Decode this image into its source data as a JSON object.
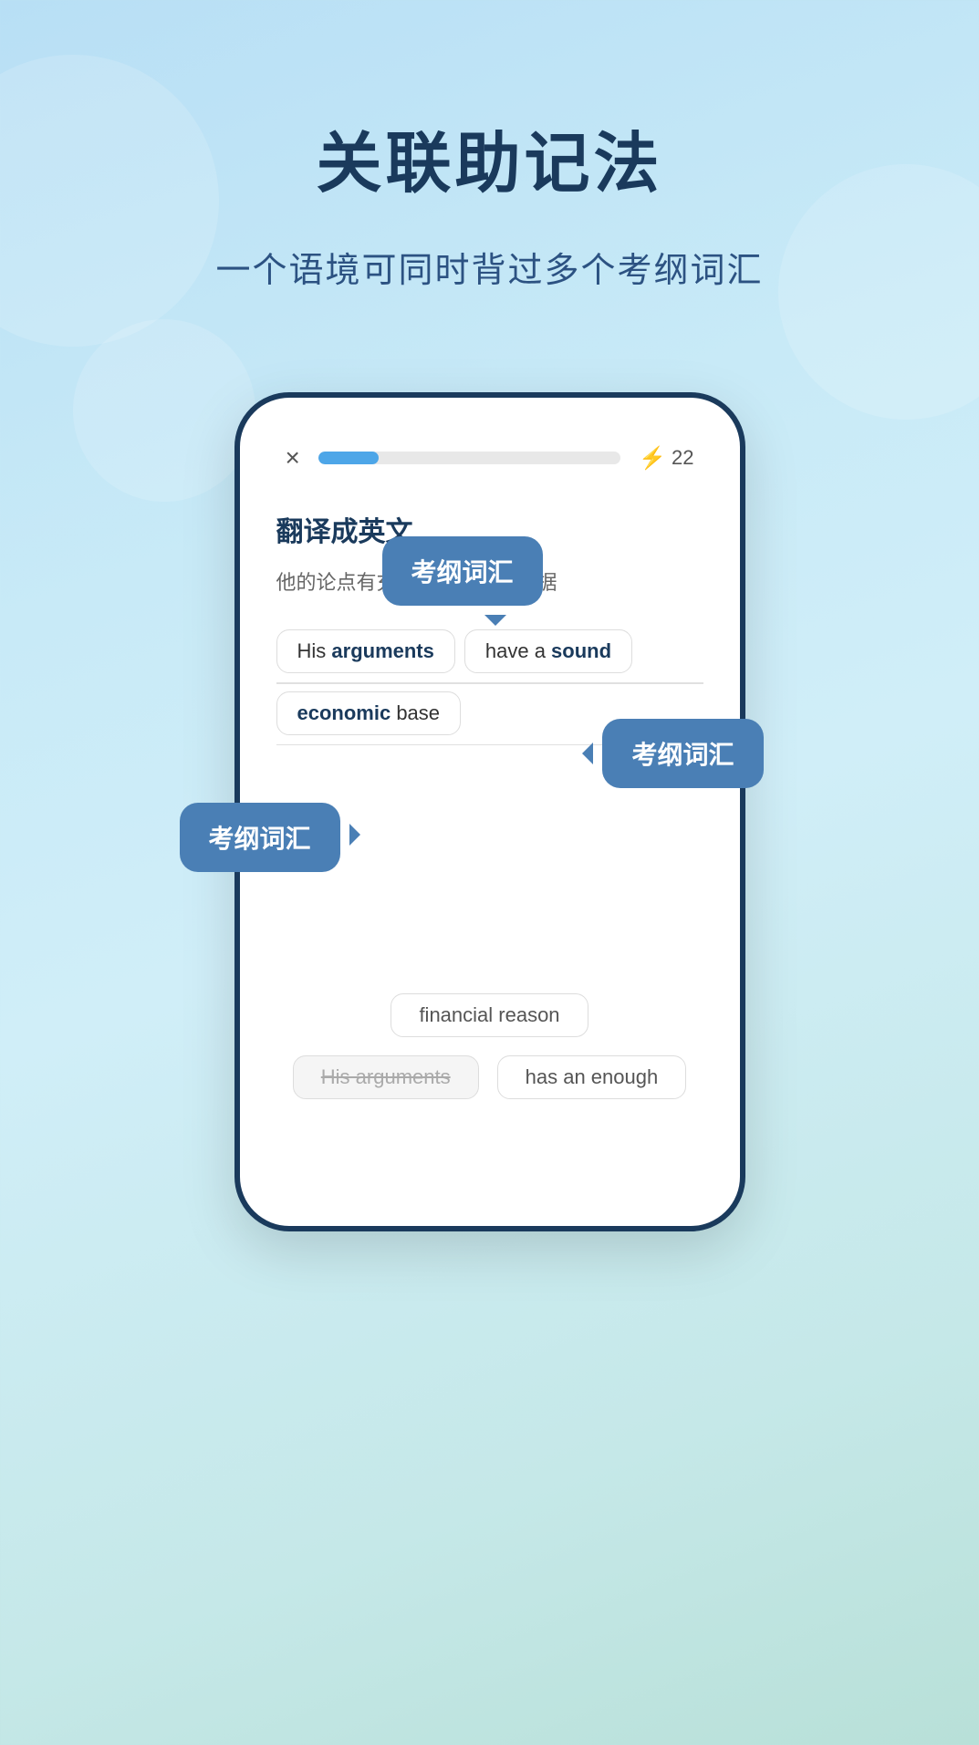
{
  "background": {
    "gradient_start": "#b8dff5",
    "gradient_end": "#b8e0d8"
  },
  "header": {
    "title": "关联助记法",
    "subtitle": "一个语境可同时背过多个考纲词汇"
  },
  "phone": {
    "topbar": {
      "close_icon": "×",
      "progress_percent": 20,
      "lightning_icon": "⚡",
      "score": "22"
    },
    "card": {
      "label": "翻译成英文",
      "chinese_text": "他的论点有充分的经济上的根据",
      "answer_line1_part1": "His ",
      "answer_line1_bold1": "arguments",
      "answer_line1_part2": "have a ",
      "answer_line1_bold2": "sound",
      "answer_line2_bold": "economic",
      "answer_line2_text": " base",
      "bottom_options": {
        "option1": "financial reason",
        "option2_wrong": "His arguments",
        "option3": "has an enough"
      }
    },
    "tooltips": {
      "bubble1": "考纲词汇",
      "bubble2": "考纲词汇",
      "bubble3": "考纲词汇"
    }
  }
}
